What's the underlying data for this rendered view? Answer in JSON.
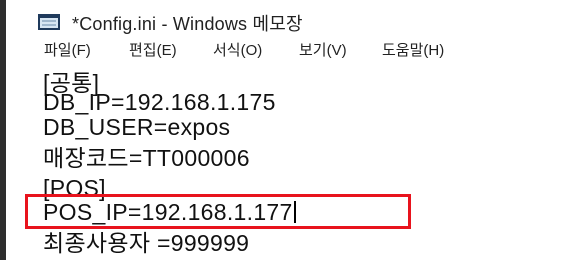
{
  "window": {
    "title": "*Config.ini - Windows 메모장",
    "menu": [
      {
        "label": "파일(F)"
      },
      {
        "label": "편집(E)"
      },
      {
        "label": "서식(O)"
      },
      {
        "label": "보기(V)"
      },
      {
        "label": "도움말(H)"
      }
    ]
  },
  "editor": {
    "lines": [
      "[공통]",
      "DB_IP=192.168.1.175",
      "DB_USER=expos",
      "매장코드=TT000006",
      "",
      "[POS]",
      "POS_IP=192.168.1.177",
      "최종사용자 =999999"
    ]
  },
  "colors": {
    "highlight_border": "#e8131d",
    "text": "#111111"
  },
  "icons": {
    "app": "notepad-icon"
  }
}
